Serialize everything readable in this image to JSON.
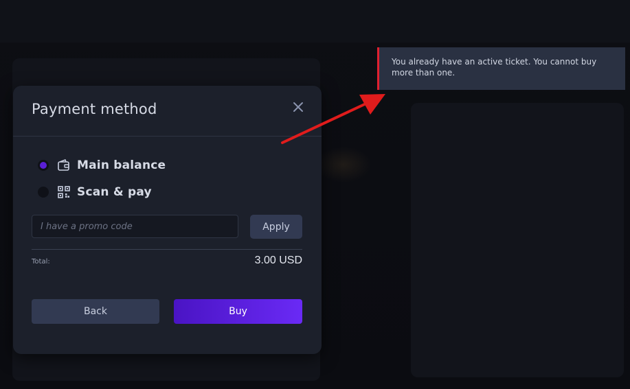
{
  "modal": {
    "title": "Payment method",
    "close_icon": "close-icon",
    "options": [
      {
        "label": "Main balance",
        "icon": "wallet-icon",
        "selected": true
      },
      {
        "label": "Scan & pay",
        "icon": "qr-code-icon",
        "selected": false
      }
    ],
    "promo": {
      "placeholder": "I have a promo code",
      "value": "",
      "apply_label": "Apply"
    },
    "total": {
      "label": "Total:",
      "value": "3.00 USD"
    },
    "back_label": "Back",
    "buy_label": "Buy"
  },
  "toast": {
    "message": "You already have an active ticket. You cannot buy more than one.",
    "accent_color": "#e12030"
  },
  "annotation": {
    "arrow_color": "#e01c1c",
    "arrow_icon": "red-arrow-icon"
  },
  "colors": {
    "accent": "#5a1fd6",
    "modal_bg": "#1c202b"
  }
}
